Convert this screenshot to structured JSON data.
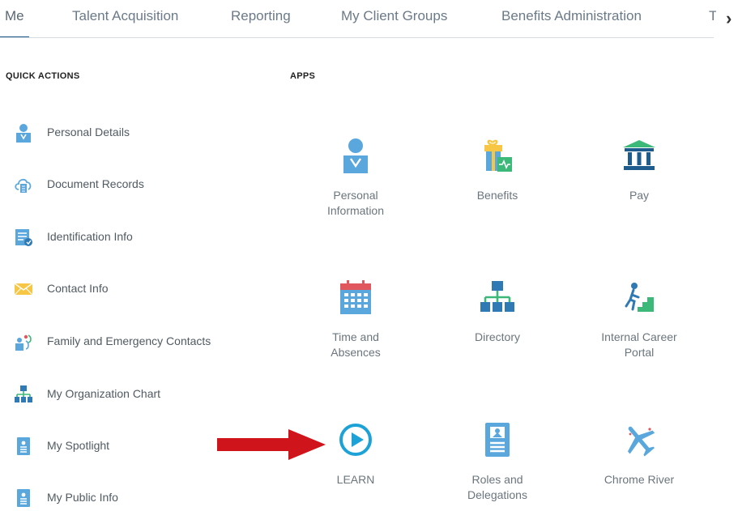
{
  "nav": {
    "tabs": [
      "Me",
      "Talent Acquisition",
      "Reporting",
      "My Client Groups",
      "Benefits Administration"
    ],
    "overflow_tab": "Too",
    "next_arrow": "›"
  },
  "quick_actions": {
    "title": "QUICK ACTIONS",
    "items": [
      {
        "label": "Personal Details",
        "icon": "person-icon"
      },
      {
        "label": "Document Records",
        "icon": "cloud-document-icon"
      },
      {
        "label": "Identification Info",
        "icon": "id-card-icon"
      },
      {
        "label": "Contact Info",
        "icon": "envelope-icon"
      },
      {
        "label": "Family and Emergency Contacts",
        "icon": "family-icon"
      },
      {
        "label": "My Organization Chart",
        "icon": "org-chart-icon"
      },
      {
        "label": "My Spotlight",
        "icon": "badge-icon"
      },
      {
        "label": "My Public Info",
        "icon": "badge-icon"
      }
    ]
  },
  "apps": {
    "title": "APPS",
    "items": [
      {
        "line1": "Personal",
        "line2": "Information",
        "icon": "person-icon"
      },
      {
        "line1": "Benefits",
        "line2": "",
        "icon": "gift-icon"
      },
      {
        "line1": "Pay",
        "line2": "",
        "icon": "bank-icon"
      },
      {
        "line1": "Time and",
        "line2": "Absences",
        "icon": "calendar-icon"
      },
      {
        "line1": "Directory",
        "line2": "",
        "icon": "org-chart-icon"
      },
      {
        "line1": "Internal Career",
        "line2": "Portal",
        "icon": "career-stairs-icon"
      },
      {
        "line1": "LEARN",
        "line2": "",
        "icon": "play-icon"
      },
      {
        "line1": "Roles and",
        "line2": "Delegations",
        "icon": "badge-icon"
      },
      {
        "line1": "Chrome River",
        "line2": "",
        "icon": "airplane-icon"
      }
    ]
  },
  "colors": {
    "accent": "#1e5c8d",
    "icon_blue": "#5aa7de",
    "arrow_red": "#d0141b"
  }
}
